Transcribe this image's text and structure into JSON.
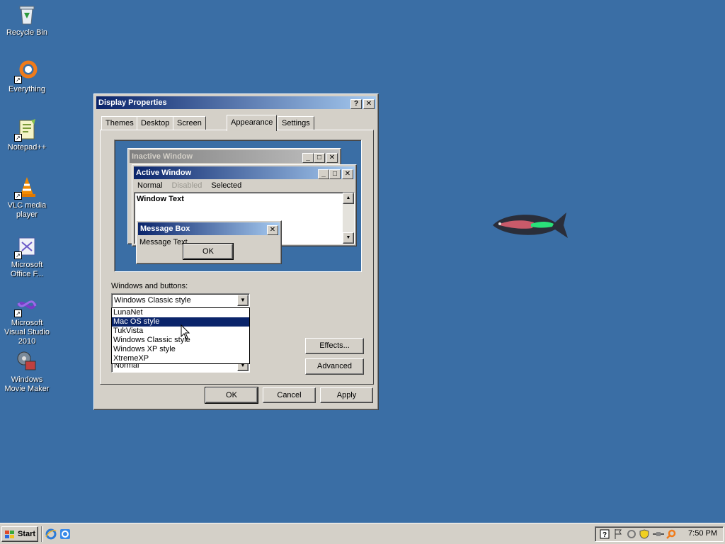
{
  "desktop": {
    "background": "#3a6ea5",
    "icons": [
      {
        "label": "Recycle Bin",
        "icon": "recycle-bin-icon"
      },
      {
        "label": "Everything",
        "icon": "everything-search-icon"
      },
      {
        "label": "Notepad++",
        "icon": "notepad-plus-plus-icon"
      },
      {
        "label": "VLC media player",
        "icon": "vlc-cone-icon"
      },
      {
        "label": "Microsoft Office F...",
        "icon": "office-icon"
      },
      {
        "label": "Microsoft Visual Studio 2010",
        "icon": "visual-studio-icon"
      },
      {
        "label": "Windows Movie Maker",
        "icon": "movie-maker-icon"
      }
    ]
  },
  "dialog": {
    "title": "Display Properties",
    "help_glyph": "?",
    "close_glyph": "✕",
    "tabs": [
      {
        "label": "Themes"
      },
      {
        "label": "Desktop"
      },
      {
        "label": "Screen Saver"
      },
      {
        "label": "Appearance",
        "active": true
      },
      {
        "label": "Settings"
      }
    ],
    "preview": {
      "inactive_title": "Inactive Window",
      "active_title": "Active Window",
      "menu": [
        "Normal",
        "Disabled",
        "Selected"
      ],
      "window_text": "Window Text",
      "message_box_title": "Message Box",
      "message_text": "Message Text",
      "ok_label": "OK"
    },
    "windows_buttons_label": "Windows and buttons:",
    "windows_buttons_value": "Windows Classic style",
    "dropdown_options": [
      "LunaNet",
      "Mac OS style",
      "TukVista",
      "Windows Classic style",
      "Windows XP style",
      "XtremeXP"
    ],
    "dropdown_selected_index": 1,
    "font_size_value": "Normal",
    "effects_label": "Effects...",
    "advanced_label": "Advanced",
    "ok_label": "OK",
    "cancel_label": "Cancel",
    "apply_label": "Apply"
  },
  "taskbar": {
    "start_label": "Start",
    "clock": "7:50 PM",
    "quicklaunch": [
      "ie-icon",
      "ie-alt-icon"
    ],
    "tray_icons": [
      "help-icon",
      "flag-icon",
      "network-icon",
      "shield-icon",
      "cable-icon",
      "search-tray-icon"
    ]
  }
}
